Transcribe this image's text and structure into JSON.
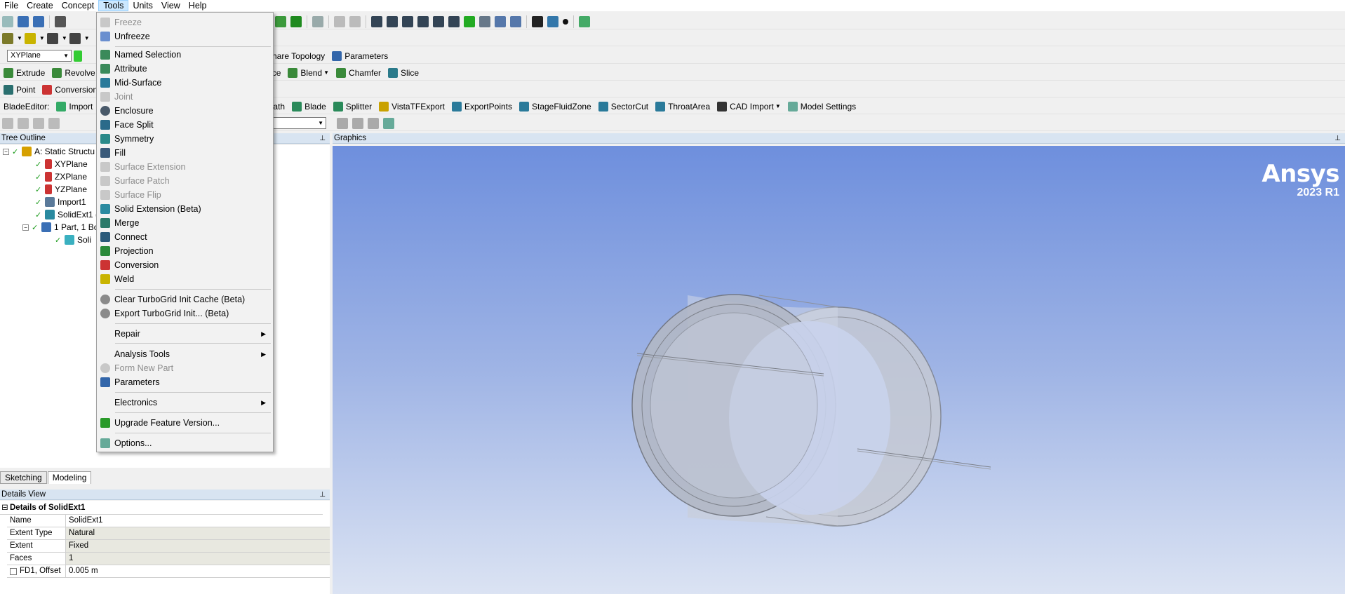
{
  "menubar": {
    "items": [
      "File",
      "Create",
      "Concept",
      "Tools",
      "Units",
      "View",
      "Help"
    ]
  },
  "toolbar_plane": {
    "plane_value": "XYPlane",
    "share_topology": "Share Topology",
    "parameters": "Parameters"
  },
  "toolbar_features": {
    "extrude": "Extrude",
    "revolve": "Revolve",
    "surface_partial": "ce",
    "blend": "Blend",
    "chamfer": "Chamfer",
    "slice": "Slice"
  },
  "toolbar_point": {
    "point": "Point",
    "conversion": "Conversion"
  },
  "toolbar_blade": {
    "label": "BladeEditor:",
    "import": "Import",
    "path": "Path",
    "blade": "Blade",
    "splitter": "Splitter",
    "vistatf": "VistaTFExport",
    "exportpoints": "ExportPoints",
    "stagefluid": "StageFluidZone",
    "sectorcut": "SectorCut",
    "throatarea": "ThroatArea",
    "cadimport": "CAD Import",
    "modelsettings": "Model Settings"
  },
  "tree": {
    "header": "Tree Outline",
    "root": "A: Static Structu",
    "xy": "XYPlane",
    "zx": "ZXPlane",
    "yz": "YZPlane",
    "import1": "Import1",
    "solidext": "SolidExt1 (",
    "parts": "1 Part, 1 Bo",
    "body": "Soli"
  },
  "tabs": {
    "sketching": "Sketching",
    "modeling": "Modeling"
  },
  "details": {
    "header": "Details View",
    "title": "Details of SolidExt1",
    "rows": [
      {
        "k": "Name",
        "v": "SolidExt1"
      },
      {
        "k": "Extent Type",
        "v": "Natural"
      },
      {
        "k": "Extent",
        "v": "Fixed"
      },
      {
        "k": "Faces",
        "v": "1"
      },
      {
        "k": "FD1, Offset",
        "v": "0.005 m"
      }
    ]
  },
  "graphics": {
    "header": "Graphics",
    "brand": "Ansys",
    "version": "2023 R1"
  },
  "tools_menu": {
    "freeze": "Freeze",
    "unfreeze": "Unfreeze",
    "named_selection": "Named Selection",
    "attribute": "Attribute",
    "mid_surface": "Mid-Surface",
    "joint": "Joint",
    "enclosure": "Enclosure",
    "face_split": "Face Split",
    "symmetry": "Symmetry",
    "fill": "Fill",
    "surface_extension": "Surface Extension",
    "surface_patch": "Surface Patch",
    "surface_flip": "Surface Flip",
    "solid_extension": "Solid Extension (Beta)",
    "merge": "Merge",
    "connect": "Connect",
    "projection": "Projection",
    "conversion": "Conversion",
    "weld": "Weld",
    "clear_turbogrid": "Clear TurboGrid Init Cache (Beta)",
    "export_turbogrid": "Export TurboGrid Init... (Beta)",
    "repair": "Repair",
    "analysis_tools": "Analysis Tools",
    "form_new_part": "Form New Part",
    "parameters": "Parameters",
    "electronics": "Electronics",
    "upgrade": "Upgrade Feature Version...",
    "options": "Options..."
  },
  "colors": {
    "menu_highlight": "#cce8ff",
    "graphics_top": "#6e8fdd",
    "graphics_bottom": "#dbe3f3"
  }
}
